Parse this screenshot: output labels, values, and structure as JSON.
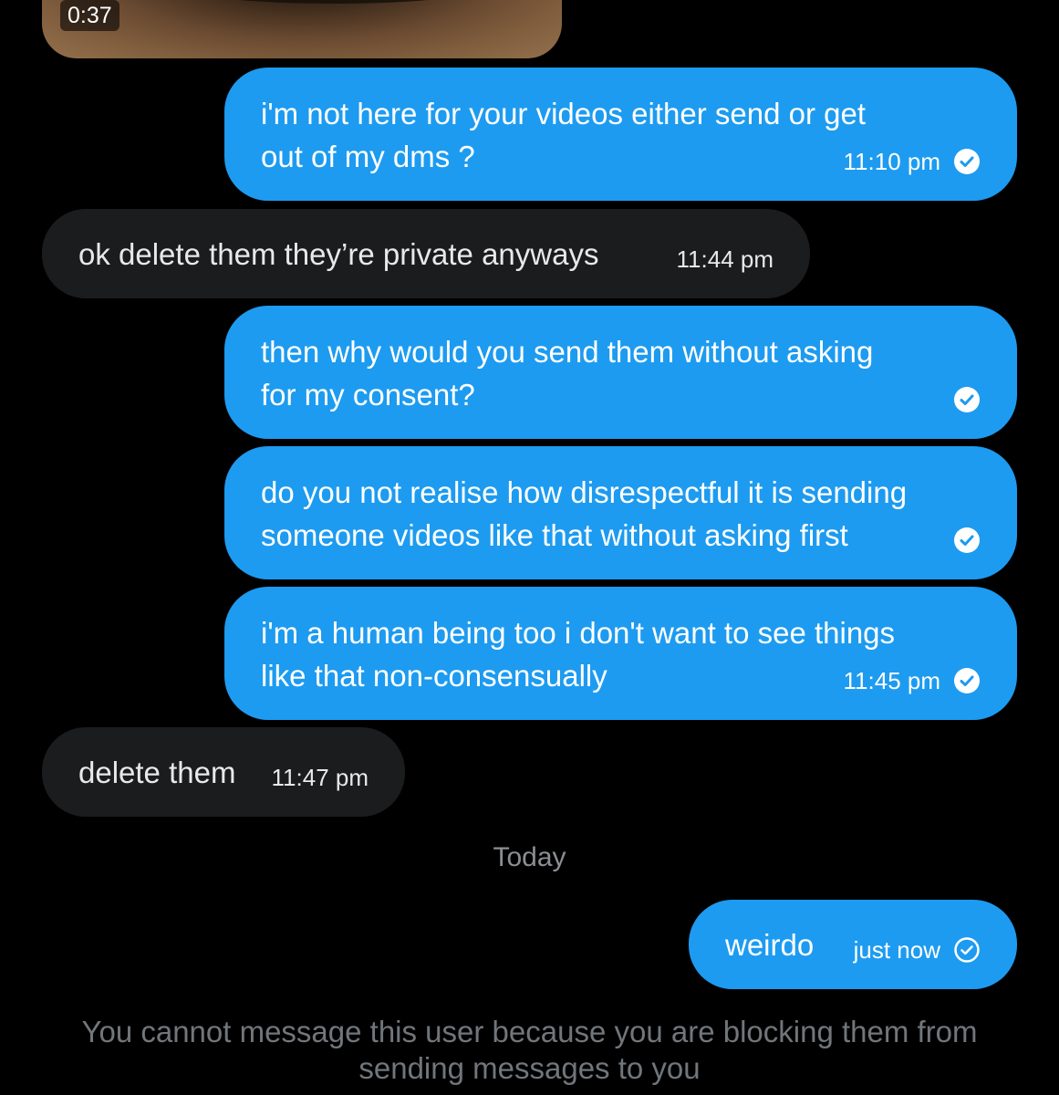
{
  "video": {
    "duration": "0:37"
  },
  "messages": [
    {
      "direction": "sent",
      "text": "i'm not here for your videos either send or get\nout of my dms ?",
      "time": "11:10 pm",
      "status_icon": "check-circle-filled"
    },
    {
      "direction": "received",
      "text": "ok delete them they’re private anyways",
      "time": "11:44 pm"
    },
    {
      "direction": "sent",
      "text": "then why would you send them without asking\nfor my consent?",
      "time": "",
      "status_icon": "check-circle-filled"
    },
    {
      "direction": "sent",
      "text": "do you not realise how disrespectful it is sending\nsomeone videos like that without asking first",
      "time": "",
      "status_icon": "check-circle-filled"
    },
    {
      "direction": "sent",
      "text": "i'm a human being too i don't want to see things\nlike that non-consensually",
      "time": "11:45 pm",
      "status_icon": "check-circle-filled"
    },
    {
      "direction": "received",
      "text": "delete them",
      "time": "11:47 pm"
    },
    {
      "direction": "sent",
      "text": "weirdo",
      "time": "just now",
      "status_icon": "check-circle-outline"
    }
  ],
  "day_divider": "Today",
  "blocked_notice": "You cannot message this user because you are blocking them from sending messages to you",
  "colors": {
    "sent_bubble": "#1d9bf0",
    "received_bubble": "#1b1c1e",
    "background": "#000000",
    "muted_text": "#71767b"
  }
}
